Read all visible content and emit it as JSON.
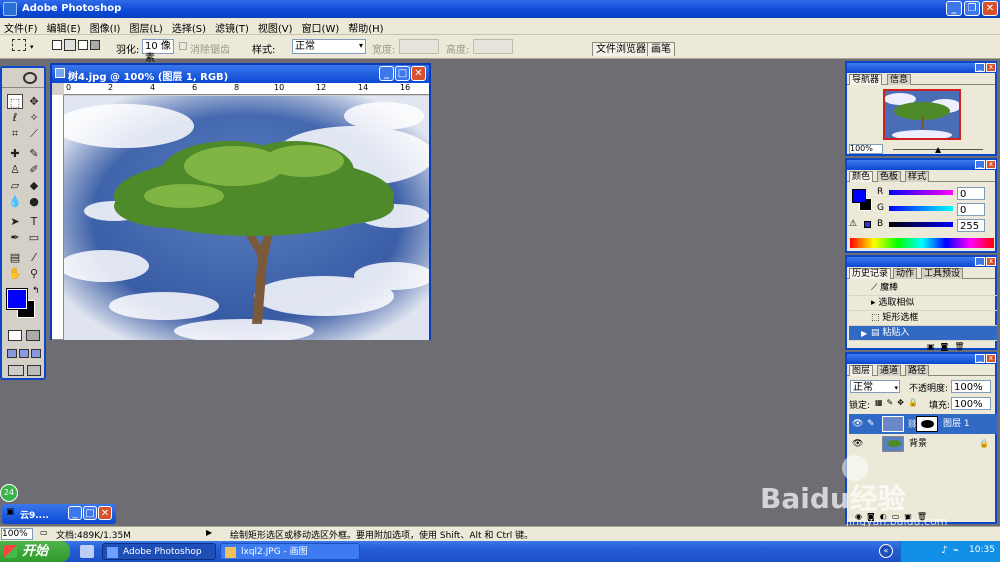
{
  "app": {
    "title": "Adobe Photoshop"
  },
  "menu": [
    "文件(F)",
    "编辑(E)",
    "图像(I)",
    "图层(L)",
    "选择(S)",
    "滤镜(T)",
    "视图(V)",
    "窗口(W)",
    "帮助(H)"
  ],
  "options": {
    "feather_label": "羽化:",
    "feather_value": "10 像素",
    "antialias_label": "消除锯齿",
    "style_label": "样式:",
    "style_value": "正常",
    "width_label": "宽度:",
    "height_label": "高度:",
    "palette_tabs": [
      "文件浏览器",
      "画笔"
    ]
  },
  "document": {
    "title": "树4.jpg @ 100% (图层 1, RGB)",
    "ruler_ticks": [
      "0",
      "2",
      "4",
      "6",
      "8",
      "10",
      "12",
      "14",
      "16"
    ]
  },
  "navigator": {
    "tabs": [
      "导航器",
      "信息"
    ],
    "zoom": "100%"
  },
  "color": {
    "tabs": [
      "颜色",
      "色板",
      "样式"
    ],
    "channels": [
      {
        "name": "R",
        "value": "0"
      },
      {
        "name": "G",
        "value": "0"
      },
      {
        "name": "B",
        "value": "255"
      }
    ],
    "foreground": "#0000ff",
    "background": "#000000"
  },
  "history": {
    "tabs": [
      "历史记录",
      "动作",
      "工具预设"
    ],
    "items": [
      {
        "label": "魔棒",
        "selected": false
      },
      {
        "label": "选取相似",
        "selected": false
      },
      {
        "label": "矩形选框",
        "selected": false
      },
      {
        "label": "粘贴入",
        "selected": true
      }
    ]
  },
  "layers": {
    "tabs": [
      "图层",
      "通道",
      "路径"
    ],
    "blend_mode": "正常",
    "opacity_label": "不透明度:",
    "opacity": "100%",
    "lock_label": "锁定:",
    "fill_label": "填充:",
    "fill": "100%",
    "items": [
      {
        "name": "图层 1",
        "selected": true
      },
      {
        "name": "背景",
        "selected": false
      }
    ]
  },
  "minimized": {
    "title": "云9...."
  },
  "status": {
    "zoom": "100%",
    "doc": "文档:489K/1.35M",
    "hint": "绘制矩形选区或移动选区外框。要用附加选项，使用 Shift、Alt 和 Ctrl 键。"
  },
  "taskbar": {
    "start": "开始",
    "tasks": [
      "Adobe Photoshop",
      "lxql2.JPG - 画图"
    ],
    "clock": "10:35",
    "badge": "24"
  },
  "watermark": {
    "brand": "Baidu经验",
    "url": "jingyan.baidu.com"
  },
  "colors": {
    "xp_blue": "#0a48d3",
    "selection": "#316ac5",
    "workspace": "#6e6d73"
  }
}
